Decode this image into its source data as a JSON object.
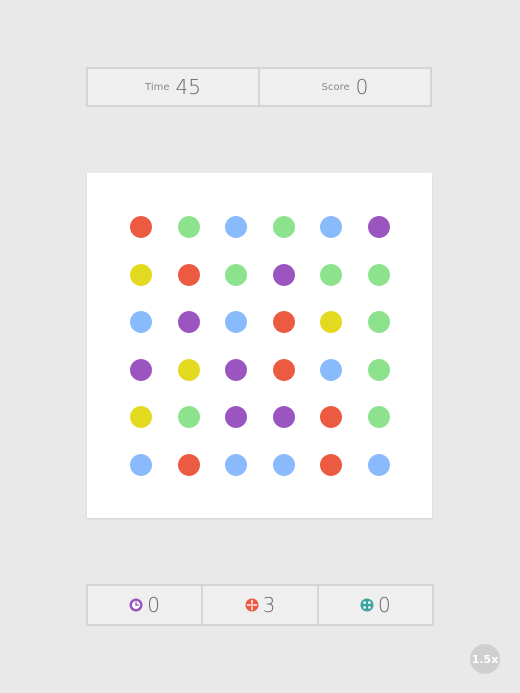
{
  "stats": {
    "time_label": "Time",
    "time_value": "45",
    "score_label": "Score",
    "score_value": "0"
  },
  "colors": {
    "R": "#ec5a41",
    "G": "#8de38d",
    "B": "#89bafc",
    "P": "#9a55c1",
    "Y": "#e3d91f"
  },
  "board": {
    "rows": [
      [
        "R",
        "G",
        "B",
        "G",
        "B",
        "P"
      ],
      [
        "Y",
        "R",
        "G",
        "P",
        "G",
        "G"
      ],
      [
        "B",
        "P",
        "B",
        "R",
        "Y",
        "G"
      ],
      [
        "P",
        "Y",
        "P",
        "R",
        "B",
        "G"
      ],
      [
        "Y",
        "G",
        "P",
        "P",
        "R",
        "G"
      ],
      [
        "B",
        "R",
        "B",
        "B",
        "R",
        "B"
      ]
    ]
  },
  "powerups": [
    {
      "icon": "time-stop-icon",
      "count": "0",
      "color": "#9a55c1"
    },
    {
      "icon": "shrinker-icon",
      "count": "3",
      "color": "#ec5a41"
    },
    {
      "icon": "expander-icon",
      "count": "0",
      "color": "#3fa3a0"
    }
  ],
  "speed_badge": "1.5x"
}
